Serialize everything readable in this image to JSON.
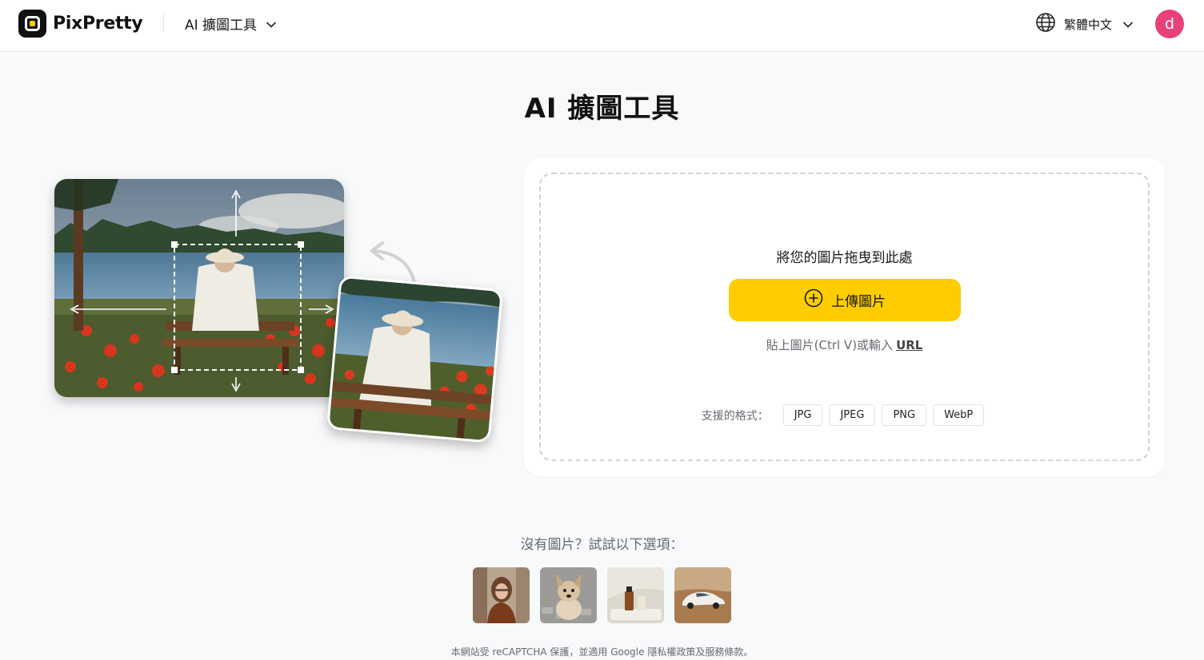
{
  "header": {
    "brand": "PixPretty",
    "tool_menu_label": "AI 擴圖工具",
    "language_label": "繁體中文",
    "avatar_initial": "d"
  },
  "main": {
    "title": "AI 擴圖工具",
    "drop_text": "將您的圖片拖曳到此處",
    "upload_button_label": "上傳圖片",
    "paste_text": "貼上圖片(Ctrl V)或輸入",
    "url_link_label": "URL",
    "formats_label": "支援的格式：",
    "formats": [
      "JPG",
      "JPEG",
      "PNG",
      "WebP"
    ]
  },
  "samples": {
    "label": "沒有圖片？試試以下選項："
  },
  "footer": {
    "note": "本網站受 reCAPTCHA 保護，並適用 Google 隱私權政策及服務條款。"
  },
  "colors": {
    "accent": "#ffcc00",
    "avatar": "#e8417a",
    "background": "#f8f9fb"
  }
}
